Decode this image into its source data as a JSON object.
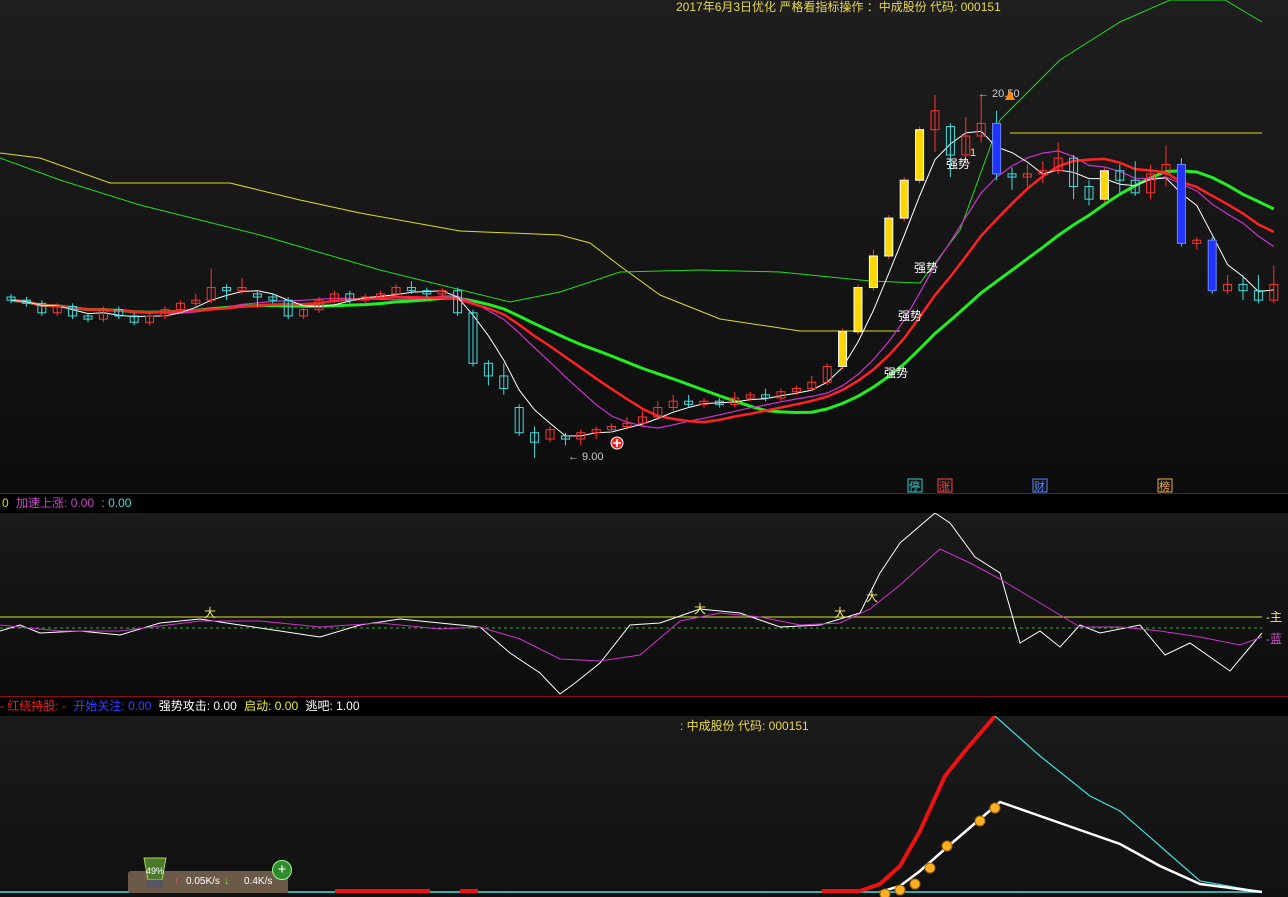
{
  "header": {
    "title": "2017年6月3日优化 严格看指标操作 ：中成股份 代码: 000151"
  },
  "main_chart": {
    "annotations": {
      "high_label": "20.50",
      "low_label": "9.00",
      "strong_label": "强势",
      "small_num": "1"
    },
    "markers": [
      "停",
      "涨",
      "财",
      "榜"
    ]
  },
  "indicator_bar": {
    "items": [
      {
        "label": "0",
        "color": "#dddd00"
      },
      {
        "label": "加速上涨: 0.00",
        "color": "#cc44cc"
      },
      {
        "label": ": 0.00",
        "color": "#44dddd"
      }
    ]
  },
  "osc_panel": {
    "signal": "大",
    "labels": [
      "主",
      "蓝"
    ]
  },
  "status_bar": {
    "items": [
      {
        "label": "- 红绕持股: -",
        "color": "#ee2222"
      },
      {
        "label": "开始关注: 0.00",
        "color": "#3344ff"
      },
      {
        "label": "强势攻击: 0.00",
        "color": "#ffffff"
      },
      {
        "label": "启动: 0.00",
        "color": "#eeee33"
      },
      {
        "label": "逃吧: 1.00",
        "color": "#ffffff"
      }
    ]
  },
  "bottom_panel": {
    "title": ": 中成股份 代码: 000151"
  },
  "widget": {
    "percent": "49%",
    "upload": "0.05K/s",
    "download": "0.4K/s"
  },
  "colors": {
    "up": "#ff3333",
    "down": "#44dddd",
    "ma_red": "#ff2222",
    "ma_green": "#22dd22",
    "ma_yellow": "#dddd22",
    "ma_magenta": "#cc33cc",
    "white": "#ffffff"
  },
  "chart_data": {
    "type": "candlestick",
    "y_range": [
      9.0,
      20.5
    ],
    "low_price": 9.0,
    "high_price": 20.5,
    "candles": [
      {
        "o": 14.1,
        "c": 14.0,
        "h": 14.2,
        "l": 13.9
      },
      {
        "o": 14.0,
        "c": 13.9,
        "h": 14.1,
        "l": 13.8
      },
      {
        "o": 13.9,
        "c": 13.6,
        "h": 14.0,
        "l": 13.5
      },
      {
        "o": 13.6,
        "c": 13.8,
        "h": 13.9,
        "l": 13.5
      },
      {
        "o": 13.8,
        "c": 13.5,
        "h": 13.9,
        "l": 13.4
      },
      {
        "o": 13.5,
        "c": 13.4,
        "h": 13.6,
        "l": 13.3
      },
      {
        "o": 13.4,
        "c": 13.7,
        "h": 13.8,
        "l": 13.3
      },
      {
        "o": 13.7,
        "c": 13.5,
        "h": 13.8,
        "l": 13.4
      },
      {
        "o": 13.5,
        "c": 13.3,
        "h": 13.6,
        "l": 13.2
      },
      {
        "o": 13.3,
        "c": 13.5,
        "h": 13.6,
        "l": 13.2
      },
      {
        "o": 13.5,
        "c": 13.7,
        "h": 13.8,
        "l": 13.4
      },
      {
        "o": 13.7,
        "c": 13.9,
        "h": 14.0,
        "l": 13.6
      },
      {
        "o": 13.9,
        "c": 14.0,
        "h": 14.2,
        "l": 13.8
      },
      {
        "o": 14.0,
        "c": 14.4,
        "h": 15.0,
        "l": 13.9
      },
      {
        "o": 14.4,
        "c": 14.3,
        "h": 14.5,
        "l": 14.0
      },
      {
        "o": 14.3,
        "c": 14.4,
        "h": 14.7,
        "l": 14.2
      },
      {
        "o": 14.2,
        "c": 14.1,
        "h": 14.3,
        "l": 13.8
      },
      {
        "o": 14.1,
        "c": 14.0,
        "h": 14.2,
        "l": 13.9
      },
      {
        "o": 14.0,
        "c": 13.5,
        "h": 14.1,
        "l": 13.4
      },
      {
        "o": 13.5,
        "c": 13.7,
        "h": 13.8,
        "l": 13.4
      },
      {
        "o": 13.7,
        "c": 14.0,
        "h": 14.1,
        "l": 13.6
      },
      {
        "o": 14.0,
        "c": 14.2,
        "h": 14.3,
        "l": 13.9
      },
      {
        "o": 14.2,
        "c": 14.0,
        "h": 14.3,
        "l": 13.9
      },
      {
        "o": 14.0,
        "c": 14.1,
        "h": 14.2,
        "l": 13.9
      },
      {
        "o": 14.1,
        "c": 14.2,
        "h": 14.3,
        "l": 14.0
      },
      {
        "o": 14.2,
        "c": 14.4,
        "h": 14.5,
        "l": 14.1
      },
      {
        "o": 14.4,
        "c": 14.3,
        "h": 14.6,
        "l": 14.2
      },
      {
        "o": 14.3,
        "c": 14.2,
        "h": 14.4,
        "l": 14.1
      },
      {
        "o": 14.2,
        "c": 14.3,
        "h": 14.4,
        "l": 14.1
      },
      {
        "o": 14.3,
        "c": 13.6,
        "h": 14.4,
        "l": 13.5
      },
      {
        "o": 13.6,
        "c": 12.0,
        "h": 13.7,
        "l": 11.9
      },
      {
        "o": 12.0,
        "c": 11.6,
        "h": 12.1,
        "l": 11.3
      },
      {
        "o": 11.6,
        "c": 11.2,
        "h": 12.0,
        "l": 11.0
      },
      {
        "o": 10.6,
        "c": 9.8,
        "h": 10.7,
        "l": 9.7
      },
      {
        "o": 9.8,
        "c": 9.5,
        "h": 10.0,
        "l": 9.0
      },
      {
        "o": 9.6,
        "c": 9.9,
        "h": 10.0,
        "l": 9.5
      },
      {
        "o": 9.7,
        "c": 9.6,
        "h": 9.8,
        "l": 9.4
      },
      {
        "o": 9.6,
        "c": 9.8,
        "h": 9.9,
        "l": 9.4
      },
      {
        "o": 9.8,
        "c": 9.9,
        "h": 10.0,
        "l": 9.6
      },
      {
        "o": 9.9,
        "c": 10.0,
        "h": 10.1,
        "l": 9.8
      },
      {
        "o": 10.0,
        "c": 10.1,
        "h": 10.3,
        "l": 9.9
      },
      {
        "o": 10.1,
        "c": 10.3,
        "h": 10.5,
        "l": 10.0
      },
      {
        "o": 10.3,
        "c": 10.6,
        "h": 10.8,
        "l": 10.2
      },
      {
        "o": 10.6,
        "c": 10.8,
        "h": 11.0,
        "l": 10.5
      },
      {
        "o": 10.8,
        "c": 10.7,
        "h": 11.0,
        "l": 10.6
      },
      {
        "o": 10.7,
        "c": 10.8,
        "h": 10.9,
        "l": 10.6
      },
      {
        "o": 10.8,
        "c": 10.7,
        "h": 10.9,
        "l": 10.6
      },
      {
        "o": 10.7,
        "c": 10.9,
        "h": 11.1,
        "l": 10.6
      },
      {
        "o": 10.9,
        "c": 11.0,
        "h": 11.1,
        "l": 10.8
      },
      {
        "o": 11.0,
        "c": 10.9,
        "h": 11.2,
        "l": 10.8
      },
      {
        "o": 10.9,
        "c": 11.1,
        "h": 11.2,
        "l": 10.8
      },
      {
        "o": 11.1,
        "c": 11.2,
        "h": 11.3,
        "l": 11.0
      },
      {
        "o": 11.2,
        "c": 11.4,
        "h": 11.6,
        "l": 11.1
      },
      {
        "o": 11.4,
        "c": 11.9,
        "h": 12.0,
        "l": 11.3
      },
      {
        "o": 11.9,
        "c": 13.0,
        "h": 13.1,
        "l": 11.8
      },
      {
        "o": 13.0,
        "c": 14.4,
        "h": 14.5,
        "l": 12.9
      },
      {
        "o": 14.4,
        "c": 15.4,
        "h": 15.6,
        "l": 14.3
      },
      {
        "o": 15.4,
        "c": 16.6,
        "h": 16.7,
        "l": 15.3
      },
      {
        "o": 16.6,
        "c": 17.8,
        "h": 17.9,
        "l": 16.5
      },
      {
        "o": 17.8,
        "c": 19.4,
        "h": 19.5,
        "l": 17.7
      },
      {
        "o": 19.4,
        "c": 20.0,
        "h": 20.5,
        "l": 18.7
      },
      {
        "o": 19.5,
        "c": 18.6,
        "h": 19.6,
        "l": 17.9
      },
      {
        "o": 18.6,
        "c": 19.2,
        "h": 19.8,
        "l": 18.4
      },
      {
        "o": 19.2,
        "c": 19.6,
        "h": 20.5,
        "l": 19.0
      },
      {
        "o": 19.6,
        "c": 18.0,
        "h": 20.0,
        "l": 17.8
      },
      {
        "o": 18.0,
        "c": 17.9,
        "h": 18.2,
        "l": 17.5
      },
      {
        "o": 17.9,
        "c": 18.0,
        "h": 18.3,
        "l": 17.6
      },
      {
        "o": 18.0,
        "c": 18.1,
        "h": 18.4,
        "l": 17.7
      },
      {
        "o": 18.1,
        "c": 18.5,
        "h": 19.0,
        "l": 18.0
      },
      {
        "o": 18.5,
        "c": 17.6,
        "h": 18.6,
        "l": 17.2
      },
      {
        "o": 17.6,
        "c": 17.2,
        "h": 17.8,
        "l": 17.0
      },
      {
        "o": 17.2,
        "c": 18.1,
        "h": 18.2,
        "l": 17.1
      },
      {
        "o": 18.1,
        "c": 17.8,
        "h": 18.3,
        "l": 17.4
      },
      {
        "o": 17.8,
        "c": 17.4,
        "h": 18.4,
        "l": 17.3
      },
      {
        "o": 17.4,
        "c": 18.0,
        "h": 18.3,
        "l": 17.2
      },
      {
        "o": 18.0,
        "c": 18.3,
        "h": 18.9,
        "l": 17.6
      },
      {
        "o": 18.3,
        "c": 15.8,
        "h": 18.5,
        "l": 15.7
      },
      {
        "o": 15.8,
        "c": 15.9,
        "h": 16.0,
        "l": 15.6
      },
      {
        "o": 15.9,
        "c": 14.3,
        "h": 16.0,
        "l": 14.2
      },
      {
        "o": 14.3,
        "c": 14.5,
        "h": 14.8,
        "l": 14.2
      },
      {
        "o": 14.5,
        "c": 14.3,
        "h": 14.8,
        "l": 14.0
      },
      {
        "o": 14.3,
        "c": 14.0,
        "h": 14.8,
        "l": 13.9
      },
      {
        "o": 14.0,
        "c": 14.5,
        "h": 15.1,
        "l": 13.9
      }
    ]
  }
}
